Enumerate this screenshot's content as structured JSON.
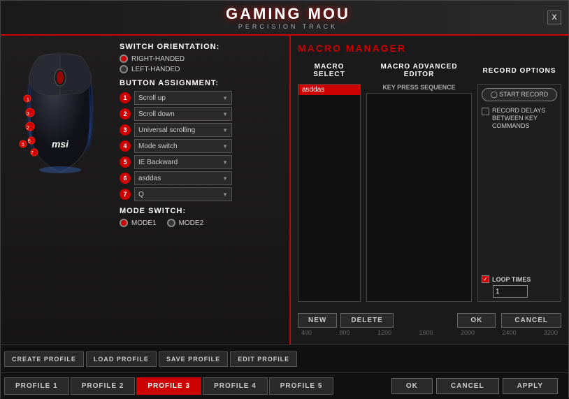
{
  "app": {
    "title": "GAMING MOU",
    "subtitle": "PERCISION  TRACK",
    "close_label": "X"
  },
  "left": {
    "switch_orientation": {
      "title": "SWITCH ORIENTATION:",
      "options": [
        "RIGHT-HANDED",
        "LEFT-HANDED"
      ],
      "selected": "RIGHT-HANDED"
    },
    "button_assignment": {
      "title": "BUTTON ASSIGNMENT:",
      "buttons": [
        {
          "id": 1,
          "value": "Scroll up"
        },
        {
          "id": 2,
          "value": "Scroll down"
        },
        {
          "id": 3,
          "value": "Universal scrolling"
        },
        {
          "id": 4,
          "value": "Mode switch"
        },
        {
          "id": 5,
          "value": "IE Backward"
        },
        {
          "id": 6,
          "value": "asddas"
        },
        {
          "id": 7,
          "value": "Q"
        }
      ]
    },
    "mode_switch": {
      "title": "MODE SWITCH:",
      "options": [
        "MODE1",
        "MODE2"
      ],
      "selected": "MODE1"
    }
  },
  "toolbar": {
    "buttons": [
      "CREATE PROFILE",
      "LOAD PROFILE",
      "SAVE PROFILE",
      "EDIT PROFILE"
    ]
  },
  "profiles": {
    "tabs": [
      "PROFILE 1",
      "PROFILE 2",
      "PROFILE 3",
      "PROFILE 4",
      "PROFILE 5"
    ],
    "active": "PROFILE 3"
  },
  "bottom_actions": {
    "ok": "OK",
    "cancel": "CANCEL",
    "apply": "APPLY"
  },
  "macro": {
    "title": "MACRO MANAGER",
    "select_label": "MACRO SELECT",
    "editor_label": "MACRO ADVANCED EDITOR",
    "key_press_label": "KEY PRESS SEQUENCE",
    "record_options_label": "RECORD OPTIONS",
    "start_record": "◯ START RECORD",
    "record_delays_label": "RECORD DELAYS BETWEEN KEY COMMANDS",
    "loop_times_label": "LOOP TIMES",
    "loop_value": "1",
    "macro_items": [
      "asddas"
    ],
    "selected_macro": "asddas",
    "new_btn": "NEW",
    "delete_btn": "DELETE",
    "ok_btn": "OK",
    "cancel_btn": "CANCEL",
    "timeline": [
      "400",
      "800",
      "1200",
      "1600",
      "2000",
      "2400",
      "3200"
    ]
  }
}
